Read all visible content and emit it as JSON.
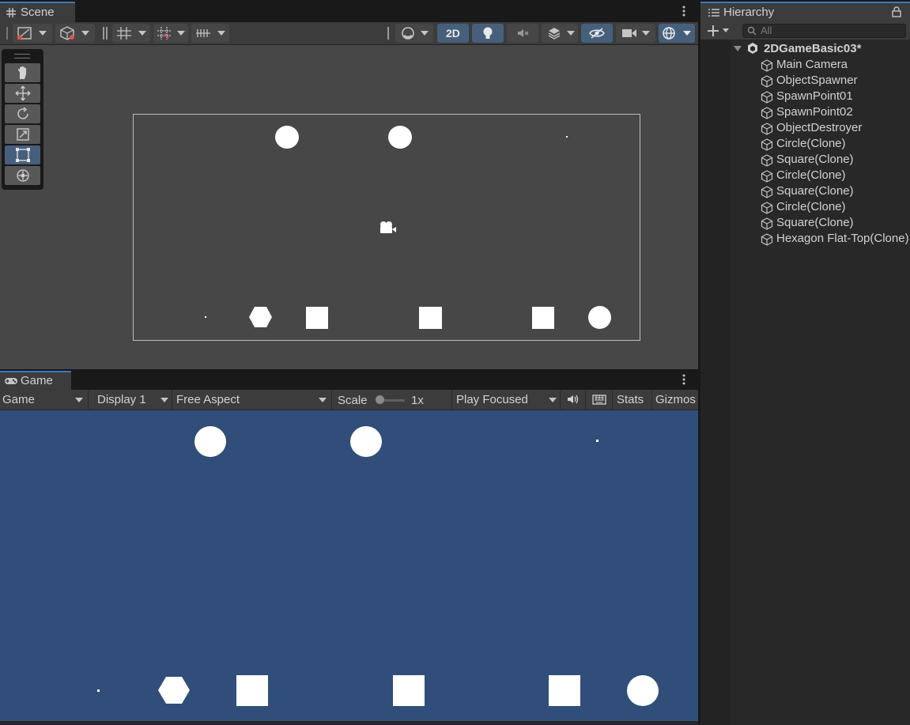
{
  "scene": {
    "tab_label": "Scene",
    "toolbar": {
      "mode_2d_label": "2D"
    },
    "tools": [
      "hand-tool-icon",
      "move-tool-icon",
      "rotate-tool-icon",
      "scale-tool-icon",
      "rect-tool-icon",
      "transform-tool-icon"
    ],
    "active_tool_index": 4
  },
  "game": {
    "tab_label": "Game",
    "toolbar": {
      "view_select": "Game",
      "display_select": "Display 1",
      "aspect_select": "Free Aspect",
      "scale_label": "Scale",
      "scale_value": "1x",
      "play_mode_select": "Play Focused",
      "stats_label": "Stats",
      "gizmos_label": "Gizmos"
    },
    "background_color": "#314d79"
  },
  "hierarchy": {
    "tab_label": "Hierarchy",
    "search_placeholder": "All",
    "scene_name": "2DGameBasic03*",
    "objects": [
      "Main Camera",
      "ObjectSpawner",
      "SpawnPoint01",
      "SpawnPoint02",
      "ObjectDestroyer",
      "Circle(Clone)",
      "Square(Clone)",
      "Circle(Clone)",
      "Square(Clone)",
      "Circle(Clone)",
      "Square(Clone)",
      "Hexagon Flat-Top(Clone)"
    ]
  },
  "colors": {
    "accent": "#3a79bb",
    "scene_bg": "#474747",
    "panel_bg": "#282828",
    "toolbar_bg": "#3c3c3c"
  }
}
